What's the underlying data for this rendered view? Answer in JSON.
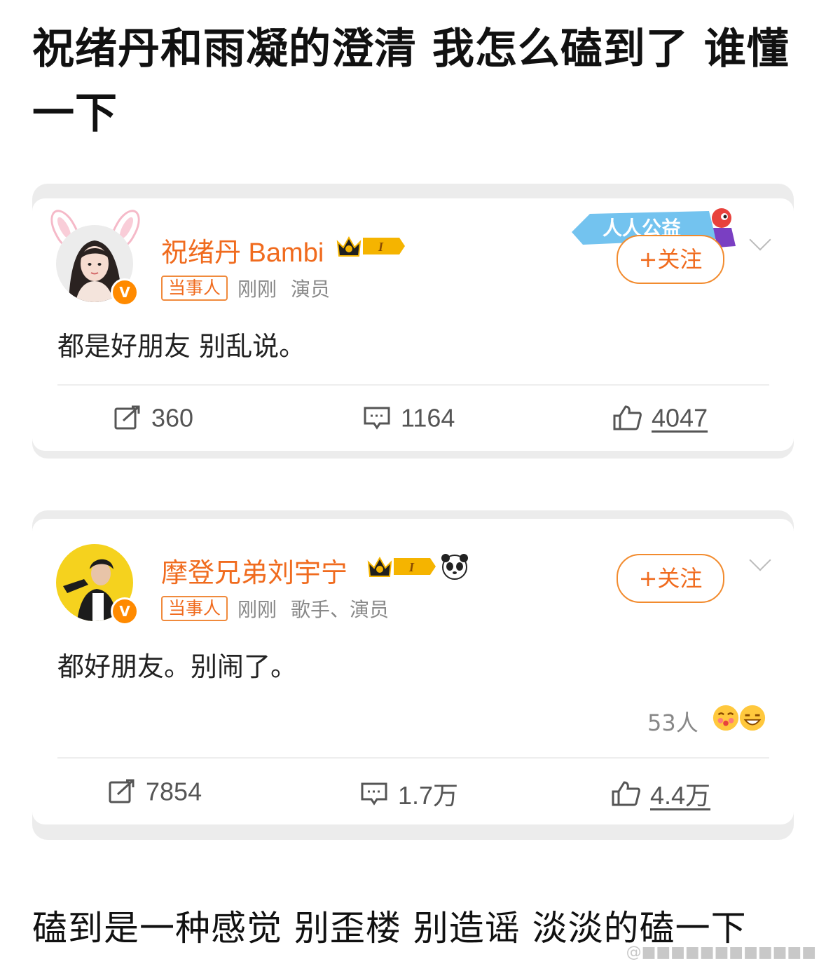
{
  "post": {
    "title": "祝绪丹和雨凝的澄清 我怎么磕到了 谁懂一下",
    "footer": "磕到是一种感觉  别歪楼 别造谣 淡淡的磕一下",
    "watermark": "@■■■■■■■■■■■■"
  },
  "posts": [
    {
      "name": "祝绪丹 Bambi",
      "vip_level": "I",
      "verified_mark": "V",
      "tag": "当事人",
      "time": "刚刚",
      "role": "演员",
      "text": "都是好朋友 别乱说。",
      "follow_label": "+关注",
      "campaign_badge": "人人公益",
      "reposts": "360",
      "comments": "1164",
      "likes": "4047"
    },
    {
      "name": "摩登兄弟刘宇宁",
      "vip_level": "I",
      "verified_mark": "V",
      "tag": "当事人",
      "time": "刚刚",
      "role": "歌手、演员",
      "text": "都好朋友。别闹了。",
      "follow_label": "+关注",
      "reaction_count": "53人",
      "reposts": "7854",
      "comments": "1.7万",
      "likes": "4.4万"
    }
  ],
  "colors": {
    "accent": "#f06b1e",
    "gold": "#f5b400",
    "verified": "#ff8a00"
  }
}
